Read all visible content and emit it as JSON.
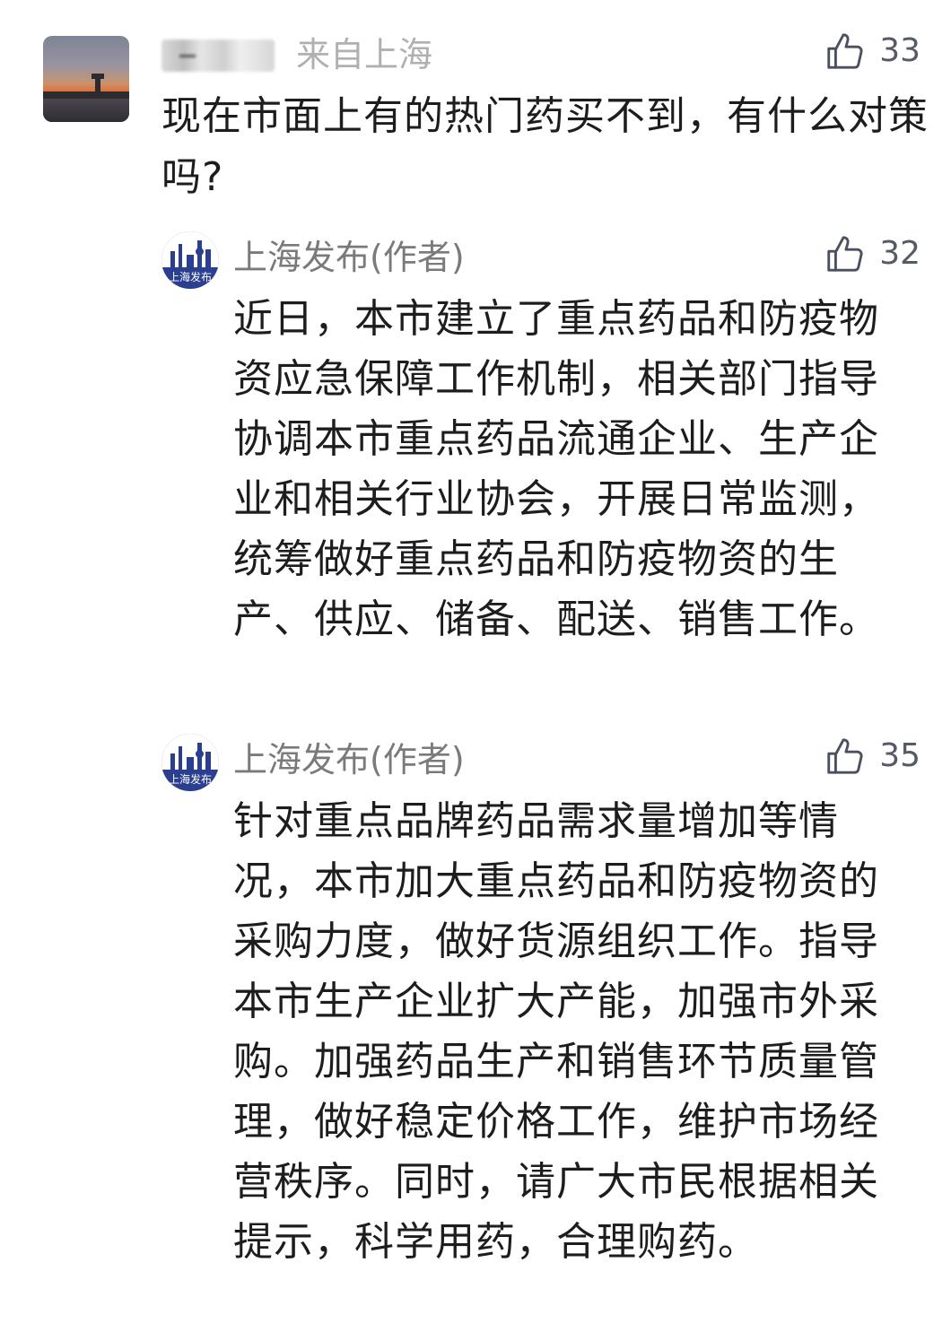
{
  "comment": {
    "username": "一",
    "location": "来自上海",
    "likes": "33",
    "text": "现在市面上有的热门药买不到，有什么对策吗?"
  },
  "replies": [
    {
      "author": "上海发布(作者)",
      "avatar_text": "上海发布",
      "likes": "32",
      "text": "近日，本市建立了重点药品和防疫物资应急保障工作机制，相关部门指导协调本市重点药品流通企业、生产企业和相关行业协会，开展日常监测，统筹做好重点药品和防疫物资的生产、供应、储备、配送、销售工作。"
    },
    {
      "author": "上海发布(作者)",
      "avatar_text": "上海发布",
      "likes": "35",
      "text": "针对重点品牌药品需求量增加等情况，本市加大重点药品和防疫物资的采购力度，做好货源组织工作。指导本市生产企业扩大产能，加强市外采购。加强药品生产和销售环节质量管理，做好稳定价格工作，维护市场经营秩序。同时，请广大市民根据相关提示，科学用药，合理购药。"
    }
  ],
  "icons": {
    "like": "thumbs-up-icon"
  },
  "colors": {
    "text": "#1d1d1f",
    "meta": "#7a7a7a",
    "logo": "#2a3f8f"
  }
}
